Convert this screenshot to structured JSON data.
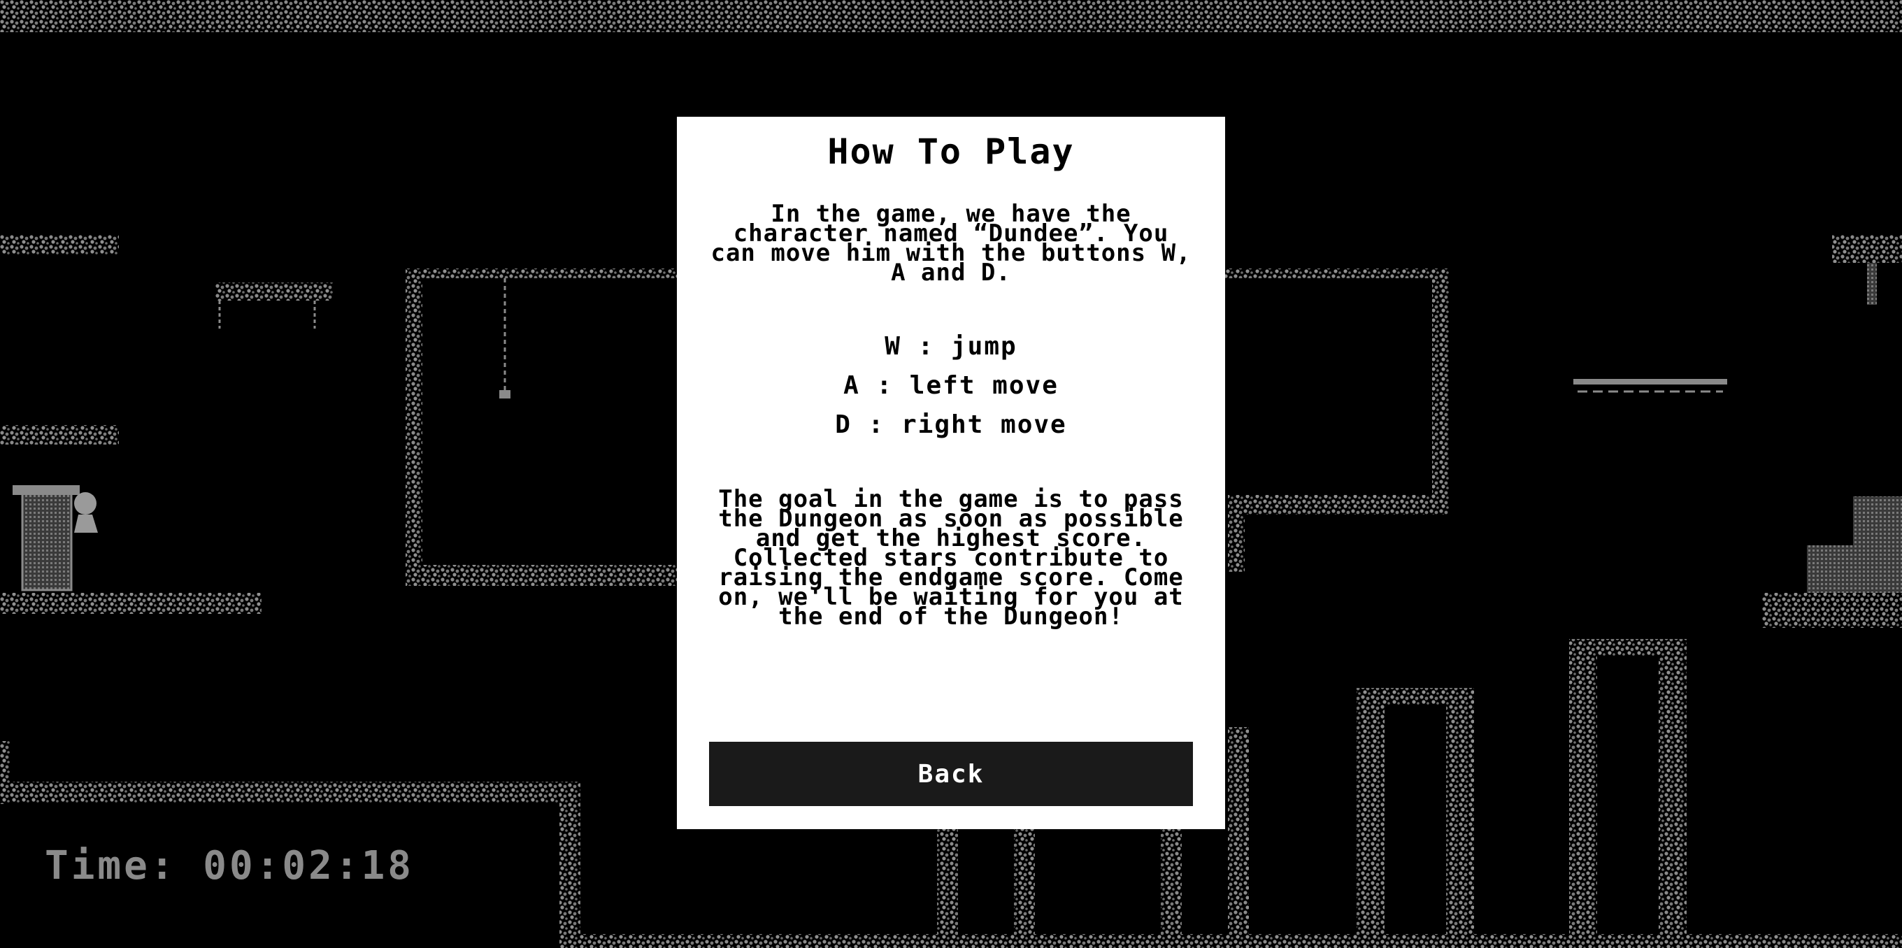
{
  "hud": {
    "time_text": "Time: 00:02:18"
  },
  "modal": {
    "title": "How To Play",
    "intro": "In the game, we have the character named “Dundee”. You can move him with the buttons W, A and D.",
    "controls": [
      {
        "text": "W : jump"
      },
      {
        "text": "A : left move"
      },
      {
        "text": "D : right move"
      }
    ],
    "goal": "The goal in the game is to pass the Dungeon as soon as possible and get the highest score. Collected stars contribute to raising the endgame score. Come on, we'll be waiting for you at the end of the Dungeon!",
    "back_label": "Back"
  },
  "colors": {
    "background": "#000000",
    "terrain": "#8a8a8a",
    "modal_bg": "#ffffff",
    "button_bg": "#1a1a1a"
  }
}
